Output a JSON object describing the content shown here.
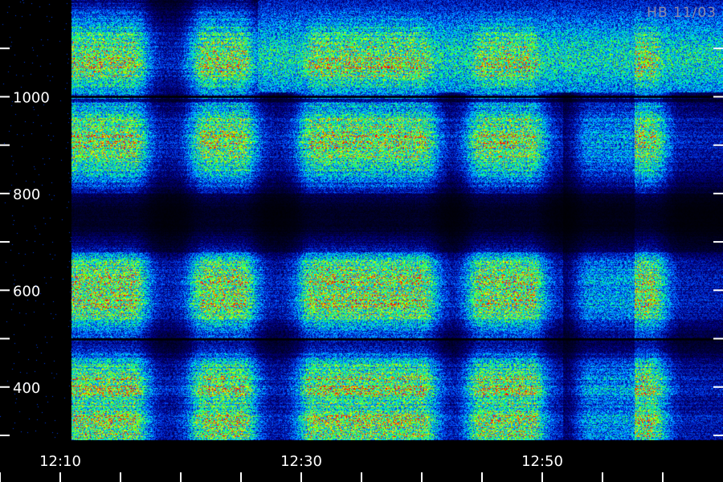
{
  "corner_label": "HB 11/03",
  "chart_data": {
    "type": "heatmap",
    "title": "",
    "xlabel": "",
    "ylabel": "",
    "x_time_range": [
      "12:05",
      "13:05"
    ],
    "y_range": [
      290,
      1200
    ],
    "x_tick_labels": [
      "12:10",
      "12:30",
      "12:50"
    ],
    "x_minor_ticks": [
      "12:05",
      "12:10",
      "12:15",
      "12:20",
      "12:25",
      "12:30",
      "12:35",
      "12:40",
      "12:45",
      "12:50",
      "12:55",
      "13:00"
    ],
    "y_tick_labels": [
      1000,
      800,
      600,
      400
    ],
    "y_minor_ticks": [
      1100,
      900,
      700,
      500,
      300
    ],
    "colormap": [
      "#000000",
      "#000088",
      "#0050ff",
      "#00d0ff",
      "#00ff80",
      "#80ff00",
      "#ffff00",
      "#ff0000"
    ],
    "signal_bursts_time": [
      "12:11-12:16",
      "12:22-12:25",
      "12:31-12:40",
      "12:45-12:49",
      "12:54-12:59"
    ],
    "bright_bands": [
      1080,
      910,
      620,
      580,
      400,
      325
    ],
    "dark_lines": [
      1000,
      500
    ]
  }
}
